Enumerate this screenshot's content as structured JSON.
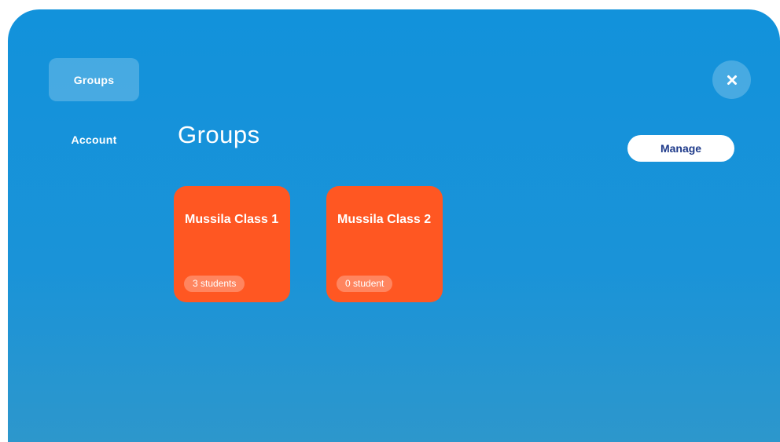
{
  "sidebar": {
    "items": [
      {
        "label": "Groups",
        "active": true
      },
      {
        "label": "Account",
        "active": false
      }
    ]
  },
  "header": {
    "title": "Groups",
    "manage_label": "Manage",
    "close_icon": "close-icon"
  },
  "groups": [
    {
      "name": "Mussila Class 1",
      "count_label": "3 students"
    },
    {
      "name": "Mussila Class 2",
      "count_label": "0 student"
    }
  ],
  "colors": {
    "background": "#1292db",
    "card": "#ff5722",
    "manage_text": "#1e3a8a"
  }
}
